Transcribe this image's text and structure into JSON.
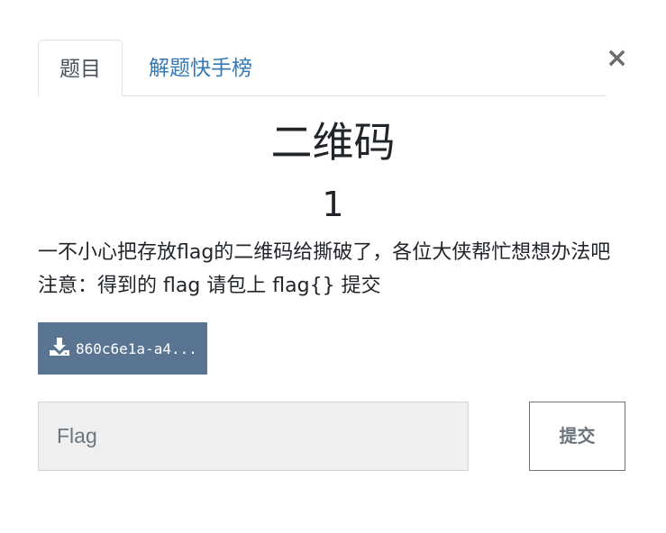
{
  "tabs": [
    {
      "label": "题目",
      "active": true
    },
    {
      "label": "解题快手榜",
      "active": false
    }
  ],
  "close": {
    "glyph": "×"
  },
  "challenge": {
    "name": "二维码",
    "points": "1",
    "description": "一不小心把存放flag的二维码给撕破了，各位大侠帮忙想想办法吧 注意：得到的 flag 请包上 flag{} 提交"
  },
  "download": {
    "icon": "download-icon",
    "label": "860c6e1a-a4..."
  },
  "flag_input": {
    "placeholder": "Flag",
    "value": ""
  },
  "submit": {
    "label": "提交"
  },
  "colors": {
    "tab_link": "#337ab7",
    "download_bg": "#5a7591",
    "input_bg": "#efefef",
    "submit_border": "#6c757d"
  }
}
